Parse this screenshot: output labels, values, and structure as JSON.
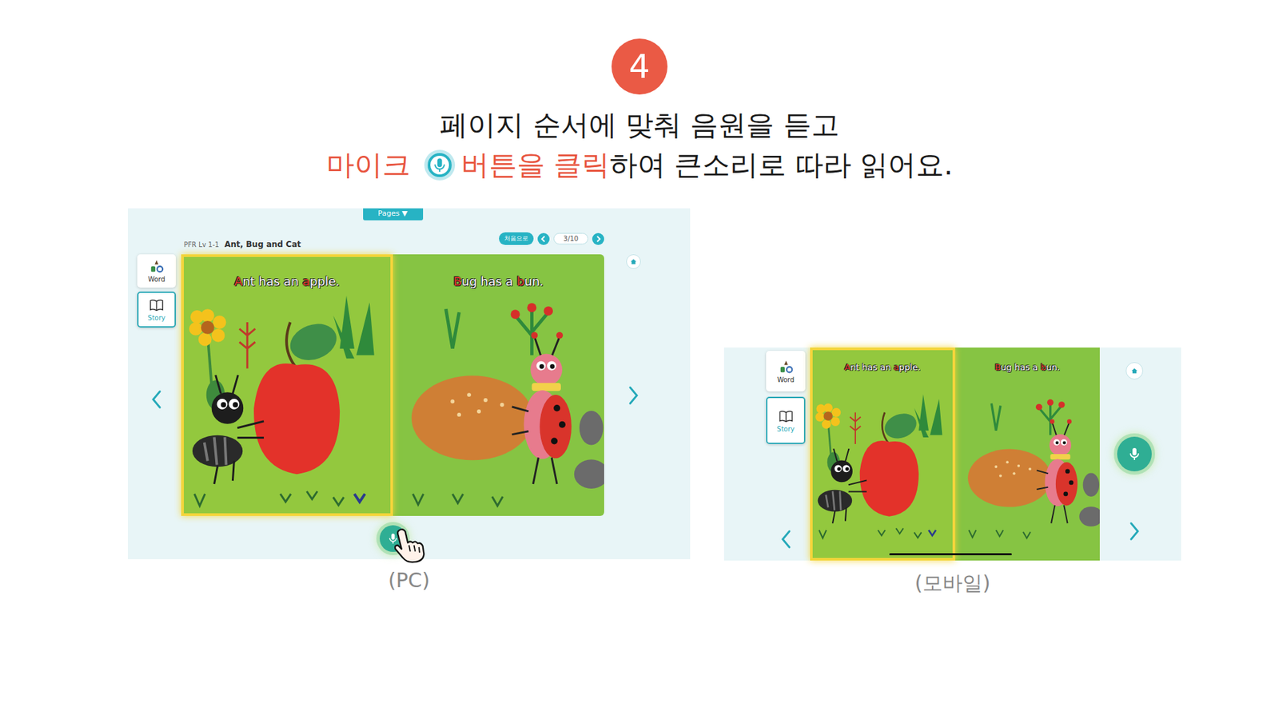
{
  "step": "4",
  "heading": {
    "line1": "페이지 순서에 맞춰 음원을 듣고",
    "line2_lead": "마이크",
    "line2_accent": "버튼을 클릭",
    "line2_rest": "하여 큰소리로 따라 읽어요."
  },
  "screens": [
    {
      "kind": "pc",
      "caption": "(PC)",
      "pages_tab": "Pages ▼",
      "header": {
        "series": "PFR Lv 1-1",
        "title": "Ant, Bug and Cat",
        "restart": "처음으로",
        "page": "3/10"
      },
      "sidebar": [
        {
          "label": "Word",
          "selected": false
        },
        {
          "label": "Story",
          "selected": true
        }
      ],
      "pages": [
        {
          "selected": true,
          "segments": [
            {
              "text": "A",
              "highlight": true
            },
            {
              "text": "nt has an ",
              "highlight": false
            },
            {
              "text": "a",
              "highlight": true
            },
            {
              "text": "pple.",
              "highlight": false
            }
          ]
        },
        {
          "selected": false,
          "segments": [
            {
              "text": "B",
              "highlight": true
            },
            {
              "text": "ug has a ",
              "highlight": false
            },
            {
              "text": "b",
              "highlight": true
            },
            {
              "text": "un.",
              "highlight": false
            }
          ]
        }
      ],
      "mic": {
        "active": true
      }
    },
    {
      "kind": "mobile",
      "caption": "(모바일)",
      "pages_tab": "",
      "header": {
        "series": "",
        "title": "",
        "restart": "",
        "page": ""
      },
      "sidebar": [
        {
          "label": "Word",
          "selected": false
        },
        {
          "label": "Story",
          "selected": true
        }
      ],
      "pages": [
        {
          "selected": true,
          "segments": [
            {
              "text": "A",
              "highlight": true
            },
            {
              "text": "nt has an ",
              "highlight": false
            },
            {
              "text": "a",
              "highlight": true
            },
            {
              "text": "pple.",
              "highlight": false
            }
          ]
        },
        {
          "selected": false,
          "segments": [
            {
              "text": "B",
              "highlight": true
            },
            {
              "text": "ug has a ",
              "highlight": false
            },
            {
              "text": "b",
              "highlight": true
            },
            {
              "text": "un.",
              "highlight": false
            }
          ]
        }
      ],
      "mic": {
        "active": true
      }
    }
  ]
}
